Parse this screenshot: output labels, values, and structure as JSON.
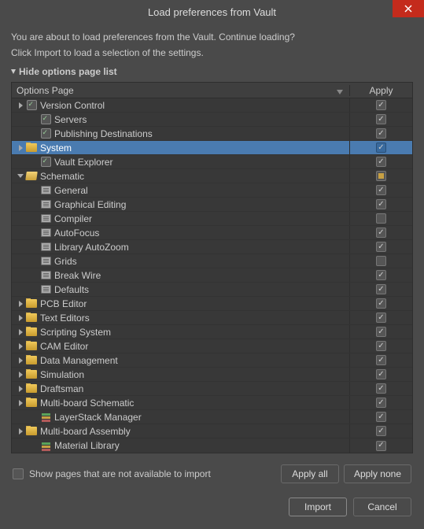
{
  "title": "Load preferences from Vault",
  "message1": "You are about to load preferences from the Vault. Continue loading?",
  "message2": "Click Import to load a selection of the settings.",
  "toggle_label": "Hide options page list",
  "columns": {
    "name": "Options Page",
    "apply": "Apply"
  },
  "rows": [
    {
      "label": "Version Control",
      "depth": 0,
      "icon": "gear",
      "expand": "right",
      "apply": "checked",
      "selected": false
    },
    {
      "label": "Servers",
      "depth": 1,
      "icon": "gear",
      "expand": "",
      "apply": "checked",
      "selected": false
    },
    {
      "label": "Publishing Destinations",
      "depth": 1,
      "icon": "gear",
      "expand": "",
      "apply": "checked",
      "selected": false
    },
    {
      "label": "System",
      "depth": 0,
      "icon": "folder",
      "expand": "right",
      "apply": "checked",
      "selected": true
    },
    {
      "label": "Vault Explorer",
      "depth": 1,
      "icon": "gear",
      "expand": "",
      "apply": "checked",
      "selected": false
    },
    {
      "label": "Schematic",
      "depth": 0,
      "icon": "folder-open",
      "expand": "down",
      "apply": "mixed",
      "selected": false
    },
    {
      "label": "General",
      "depth": 1,
      "icon": "page",
      "expand": "",
      "apply": "checked",
      "selected": false
    },
    {
      "label": "Graphical Editing",
      "depth": 1,
      "icon": "page",
      "expand": "",
      "apply": "checked",
      "selected": false
    },
    {
      "label": "Compiler",
      "depth": 1,
      "icon": "page",
      "expand": "",
      "apply": "unchecked",
      "selected": false
    },
    {
      "label": "AutoFocus",
      "depth": 1,
      "icon": "page",
      "expand": "",
      "apply": "checked",
      "selected": false
    },
    {
      "label": "Library AutoZoom",
      "depth": 1,
      "icon": "page",
      "expand": "",
      "apply": "checked",
      "selected": false
    },
    {
      "label": "Grids",
      "depth": 1,
      "icon": "page",
      "expand": "",
      "apply": "unchecked",
      "selected": false
    },
    {
      "label": "Break Wire",
      "depth": 1,
      "icon": "page",
      "expand": "",
      "apply": "checked",
      "selected": false
    },
    {
      "label": "Defaults",
      "depth": 1,
      "icon": "page",
      "expand": "",
      "apply": "checked",
      "selected": false
    },
    {
      "label": "PCB Editor",
      "depth": 0,
      "icon": "folder",
      "expand": "right",
      "apply": "checked",
      "selected": false
    },
    {
      "label": "Text Editors",
      "depth": 0,
      "icon": "folder",
      "expand": "right",
      "apply": "checked",
      "selected": false
    },
    {
      "label": "Scripting System",
      "depth": 0,
      "icon": "folder",
      "expand": "right",
      "apply": "checked",
      "selected": false
    },
    {
      "label": "CAM Editor",
      "depth": 0,
      "icon": "folder",
      "expand": "right",
      "apply": "checked",
      "selected": false
    },
    {
      "label": "Data Management",
      "depth": 0,
      "icon": "folder",
      "expand": "right",
      "apply": "checked",
      "selected": false
    },
    {
      "label": "Simulation",
      "depth": 0,
      "icon": "folder",
      "expand": "right",
      "apply": "checked",
      "selected": false
    },
    {
      "label": "Draftsman",
      "depth": 0,
      "icon": "folder",
      "expand": "right",
      "apply": "checked",
      "selected": false
    },
    {
      "label": "Multi-board Schematic",
      "depth": 0,
      "icon": "folder",
      "expand": "right",
      "apply": "checked",
      "selected": false
    },
    {
      "label": "LayerStack Manager",
      "depth": 1,
      "icon": "layers",
      "expand": "",
      "apply": "checked",
      "selected": false
    },
    {
      "label": "Multi-board Assembly",
      "depth": 0,
      "icon": "folder",
      "expand": "right",
      "apply": "checked",
      "selected": false
    },
    {
      "label": "Material Library",
      "depth": 1,
      "icon": "layers",
      "expand": "",
      "apply": "checked",
      "selected": false
    }
  ],
  "show_unavailable_label": "Show pages that are not available to import",
  "buttons": {
    "apply_all": "Apply all",
    "apply_none": "Apply none",
    "import": "Import",
    "cancel": "Cancel"
  }
}
